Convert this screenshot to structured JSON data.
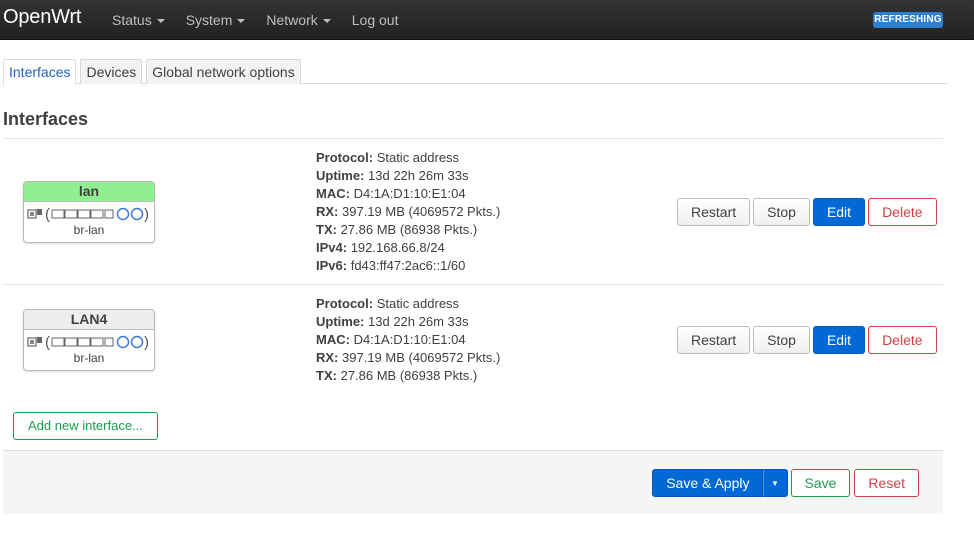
{
  "header": {
    "brand": "OpenWrt",
    "menu": [
      {
        "label": "Status",
        "dropdown": true
      },
      {
        "label": "System",
        "dropdown": true
      },
      {
        "label": "Network",
        "dropdown": true
      },
      {
        "label": "Log out",
        "dropdown": false
      }
    ],
    "status_badge": "REFRESHING"
  },
  "tabs": [
    {
      "label": "Interfaces",
      "active": true
    },
    {
      "label": "Devices",
      "active": false
    },
    {
      "label": "Global network options",
      "active": false
    }
  ],
  "page_title": "Interfaces",
  "interfaces": [
    {
      "name": "lan",
      "device": "br-lan",
      "status_color": "#90f090",
      "details": [
        {
          "label": "Protocol:",
          "value": "Static address"
        },
        {
          "label": "Uptime:",
          "value": "13d 22h 26m 33s"
        },
        {
          "label": "MAC:",
          "value": "D4:1A:D1:10:E1:04"
        },
        {
          "label": "RX:",
          "value": "397.19 MB (4069572 Pkts.)"
        },
        {
          "label": "TX:",
          "value": "27.86 MB (86938 Pkts.)"
        },
        {
          "label": "IPv4:",
          "value": "192.168.66.8/24"
        },
        {
          "label": "IPv6:",
          "value": "fd43:ff47:2ac6::1/60"
        }
      ]
    },
    {
      "name": "LAN4",
      "device": "br-lan",
      "status_color": "#eeeeee",
      "details": [
        {
          "label": "Protocol:",
          "value": "Static address"
        },
        {
          "label": "Uptime:",
          "value": "13d 22h 26m 33s"
        },
        {
          "label": "MAC:",
          "value": "D4:1A:D1:10:E1:04"
        },
        {
          "label": "RX:",
          "value": "397.19 MB (4069572 Pkts.)"
        },
        {
          "label": "TX:",
          "value": "27.86 MB (86938 Pkts.)"
        }
      ]
    }
  ],
  "row_actions": {
    "restart": "Restart",
    "stop": "Stop",
    "edit": "Edit",
    "delete": "Delete"
  },
  "add_interface_label": "Add new interface...",
  "footer": {
    "save_apply": "Save & Apply",
    "save": "Save",
    "reset": "Reset"
  },
  "colors": {
    "primary": "#0069d6",
    "positive": "#1b9d50",
    "negative": "#cc4444",
    "topbar": "#2a2a2a",
    "badge": "#2d7fd1"
  }
}
